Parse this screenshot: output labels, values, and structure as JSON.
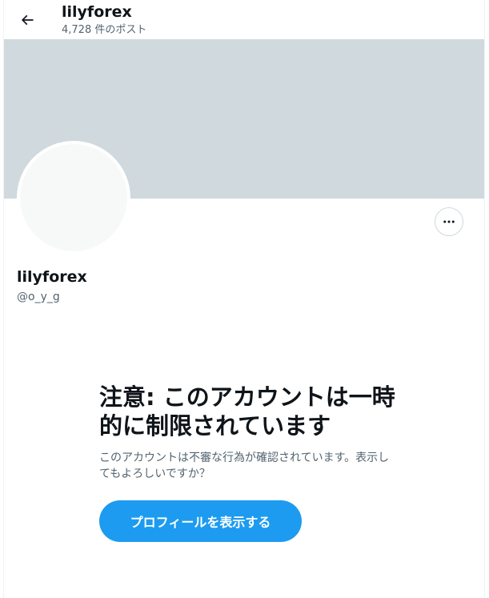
{
  "header": {
    "back_icon": "arrow-left-icon",
    "title": "lilyforex",
    "post_count": "4,728 件のポスト"
  },
  "profile": {
    "more_icon": "more-horizontal-icon",
    "display_name": "lilyforex",
    "handle": "@o_y_g",
    "banner_color": "#cfd9de",
    "avatar_color": "#f7f9f9"
  },
  "notice": {
    "title": "注意: このアカウントは一時的に制限されています",
    "body": "このアカウントは不審な行為が確認されています。表示してもよろしいですか？",
    "button_label": "プロフィールを表示する",
    "accent_color": "#1d9bf0"
  }
}
